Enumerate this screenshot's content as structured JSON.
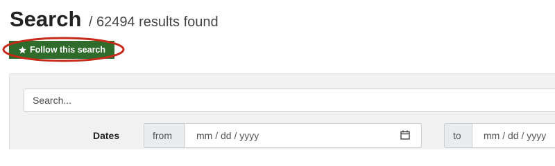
{
  "header": {
    "title": "Search",
    "subtitle": "/ 62494 results found"
  },
  "follow_button": {
    "label": "Follow this search",
    "icon": "star-icon"
  },
  "annotation": {
    "color": "#c62a1a"
  },
  "search": {
    "placeholder": "Search..."
  },
  "dates": {
    "label": "Dates",
    "from_label": "from",
    "from_placeholder": "mm / dd / yyyy",
    "to_label": "to",
    "to_placeholder": "mm / dd / yyyy",
    "icon": "calendar-icon"
  },
  "colors": {
    "button_bg": "#2f6b2a",
    "panel_bg": "#f1f1f1"
  }
}
